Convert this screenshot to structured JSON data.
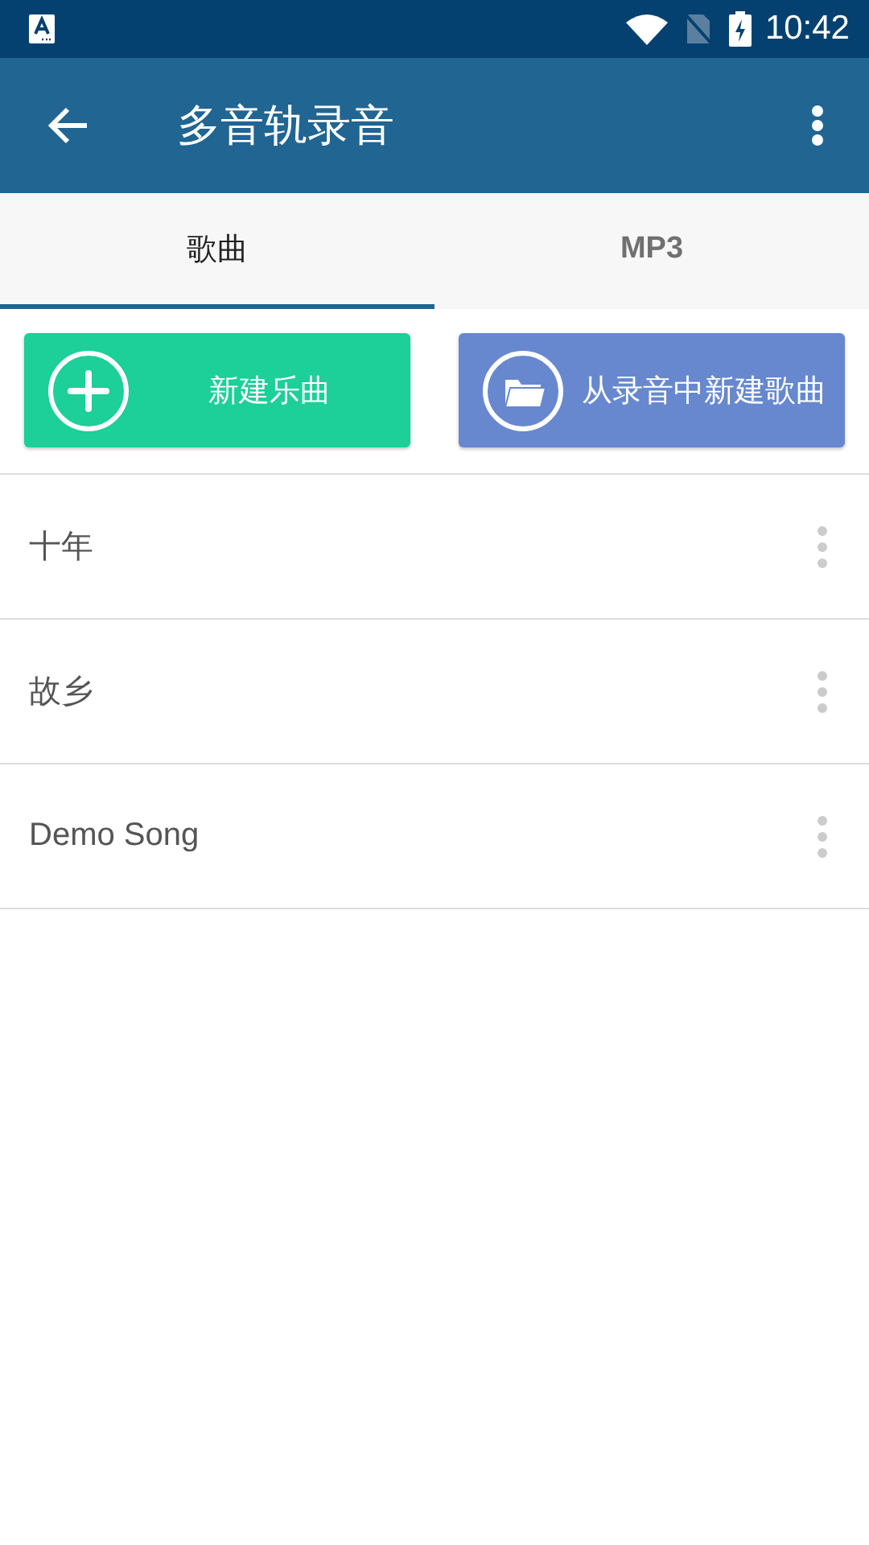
{
  "status_bar": {
    "time": "10:42"
  },
  "app_bar": {
    "title": "多音轨录音"
  },
  "tabs": [
    {
      "label": "歌曲",
      "selected": true
    },
    {
      "label": "MP3",
      "selected": false
    }
  ],
  "actions": [
    {
      "kind": "new",
      "label": "新建乐曲",
      "color": "#1dcf98"
    },
    {
      "kind": "import",
      "label": "从录音中新建歌曲",
      "color": "#6788cf"
    }
  ],
  "songs": [
    {
      "name": "十年"
    },
    {
      "name": "故乡"
    },
    {
      "name": "Demo Song"
    }
  ]
}
